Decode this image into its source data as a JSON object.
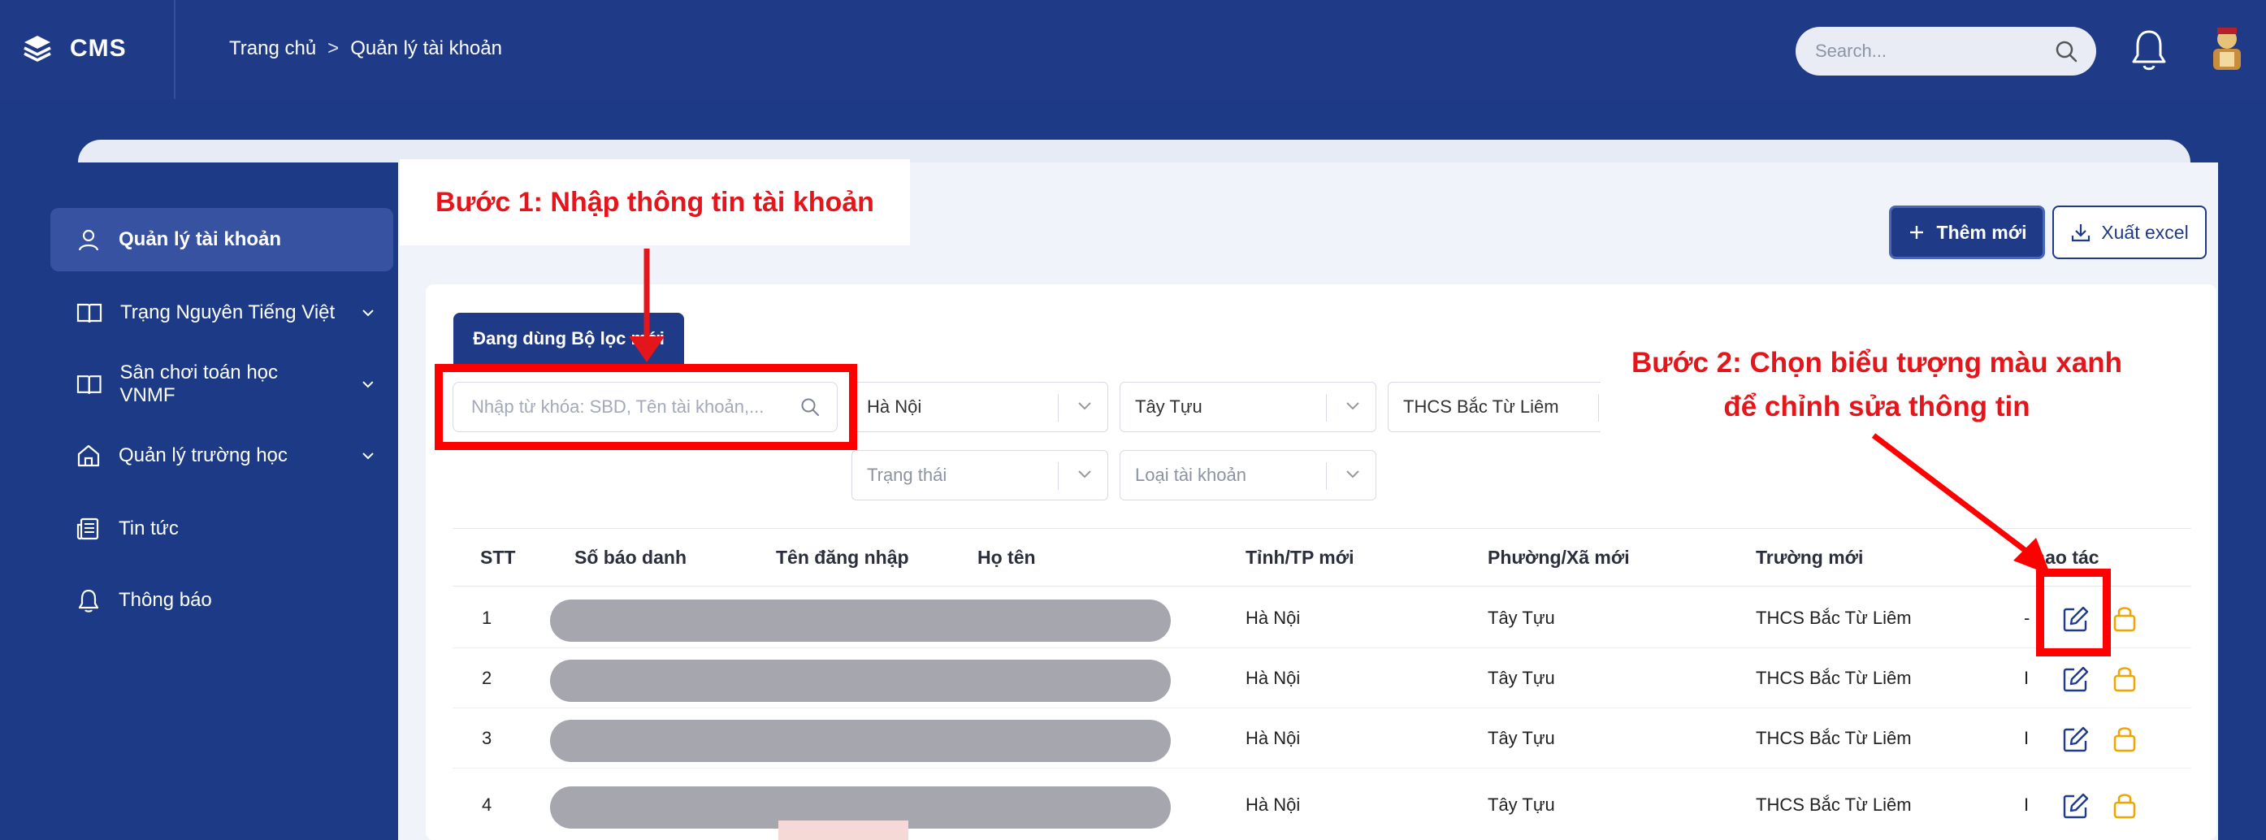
{
  "header": {
    "logo_text": "CMS",
    "breadcrumb": [
      "Trang chủ",
      "Quản lý tài khoản"
    ],
    "breadcrumb_sep": ">",
    "search_placeholder": "Search..."
  },
  "sidebar": {
    "items": [
      {
        "label": "Quản lý tài khoản",
        "icon": "user-icon",
        "active": true
      },
      {
        "label": "Trạng Nguyên Tiếng Việt",
        "icon": "book-icon",
        "chevron": true
      },
      {
        "label": "Sân chơi toán học VNMF",
        "icon": "book-icon",
        "chevron": true
      },
      {
        "label": "Quản lý trường học",
        "icon": "home-icon",
        "chevron": true
      },
      {
        "label": "Tin tức",
        "icon": "news-icon"
      },
      {
        "label": "Thông báo",
        "icon": "bell-icon"
      }
    ]
  },
  "toolbar": {
    "add_label": "Thêm mới",
    "export_label": "Xuất excel"
  },
  "filters": {
    "tag_label": "Đang dùng Bộ lọc mới",
    "keyword_placeholder": "Nhập từ khóa: SBD, Tên tài khoản,...",
    "province": "Hà Nội",
    "ward": "Tây Tựu",
    "school": "THCS Bắc Từ Liêm",
    "status_placeholder": "Trạng thái",
    "account_type_placeholder": "Loại tài khoản"
  },
  "table": {
    "headers": [
      "STT",
      "Số báo danh",
      "Tên đăng nhập",
      "Họ tên",
      "Tỉnh/TP mới",
      "Phường/Xã mới",
      "Trường mới",
      "Thao tác"
    ],
    "rows": [
      {
        "stt": "1",
        "province": "Hà Nội",
        "ward": "Tây Tựu",
        "school": "THCS Bắc Từ Liêm",
        "trunc": "-"
      },
      {
        "stt": "2",
        "province": "Hà Nội",
        "ward": "Tây Tựu",
        "school": "THCS Bắc Từ Liêm",
        "trunc": "I"
      },
      {
        "stt": "3",
        "province": "Hà Nội",
        "ward": "Tây Tựu",
        "school": "THCS Bắc Từ Liêm",
        "trunc": "I"
      },
      {
        "stt": "4",
        "province": "Hà Nội",
        "ward": "Tây Tựu",
        "school": "THCS Bắc Từ Liêm",
        "trunc": "I"
      }
    ]
  },
  "annotations": {
    "step1": "Bước 1: Nhập thông tin tài khoản",
    "step2_line1": "Bước 2: Chọn biểu tượng màu xanh",
    "step2_line2": "để chỉnh sửa thông tin"
  },
  "colors": {
    "primary": "#1f3a87",
    "annotation_red": "#ff0000",
    "edit_icon": "#1f3a87",
    "lock_icon": "#f0a500"
  }
}
